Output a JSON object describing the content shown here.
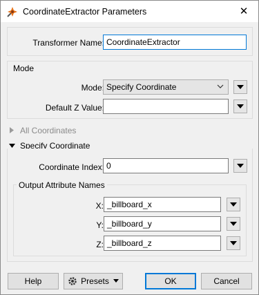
{
  "window": {
    "title": "CoordinateExtractor Parameters",
    "close_glyph": "✕"
  },
  "transformer": {
    "label": "Transformer Name:",
    "value": "CoordinateExtractor"
  },
  "mode_group": {
    "title": "Mode",
    "mode_label": "Mode:",
    "mode_value": "Specify Coordinate",
    "z_label": "Default Z Value:",
    "z_value": ""
  },
  "all_coordinates": {
    "title": "All Coordinates"
  },
  "specify_coordinate": {
    "title": "Specify Coordinate",
    "index_label": "Coordinate Index:",
    "index_value": "0",
    "output": {
      "title": "Output Attribute Names",
      "x_label": "X:",
      "x_value": "_billboard_x",
      "y_label": "Y:",
      "y_value": "_billboard_y",
      "z_label": "Z:",
      "z_value": "_billboard_z"
    }
  },
  "buttons": {
    "help": "Help",
    "presets": "Presets",
    "ok": "OK",
    "cancel": "Cancel"
  }
}
